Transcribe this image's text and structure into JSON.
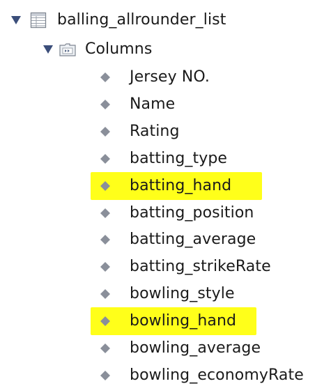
{
  "tree": {
    "table": {
      "name": "balling_allrounder_list",
      "icon": "table-icon",
      "expanded": true
    },
    "folder": {
      "name": "Columns",
      "icon": "folder-icon",
      "expanded": true
    },
    "columns": [
      {
        "name": "Jersey NO.",
        "icon": "column-diamond-icon",
        "highlighted": false
      },
      {
        "name": "Name",
        "icon": "column-diamond-icon",
        "highlighted": false
      },
      {
        "name": "Rating",
        "icon": "column-diamond-icon",
        "highlighted": false
      },
      {
        "name": "batting_type",
        "icon": "column-diamond-icon",
        "highlighted": false
      },
      {
        "name": "batting_hand",
        "icon": "column-diamond-icon",
        "highlighted": true
      },
      {
        "name": "batting_position",
        "icon": "column-diamond-icon",
        "highlighted": false
      },
      {
        "name": "batting_average",
        "icon": "column-diamond-icon",
        "highlighted": false
      },
      {
        "name": "batting_strikeRate",
        "icon": "column-diamond-icon",
        "highlighted": false
      },
      {
        "name": "bowling_style",
        "icon": "column-diamond-icon",
        "highlighted": false
      },
      {
        "name": "bowling_hand",
        "icon": "column-diamond-icon",
        "highlighted": true
      },
      {
        "name": "bowling_average",
        "icon": "column-diamond-icon",
        "highlighted": false
      },
      {
        "name": "bowling_economyRate",
        "icon": "column-diamond-icon",
        "highlighted": false
      }
    ]
  },
  "colors": {
    "highlight": "#ffff1a",
    "diamond": "#8a8f9a",
    "twisty": "#3b4e7a"
  }
}
